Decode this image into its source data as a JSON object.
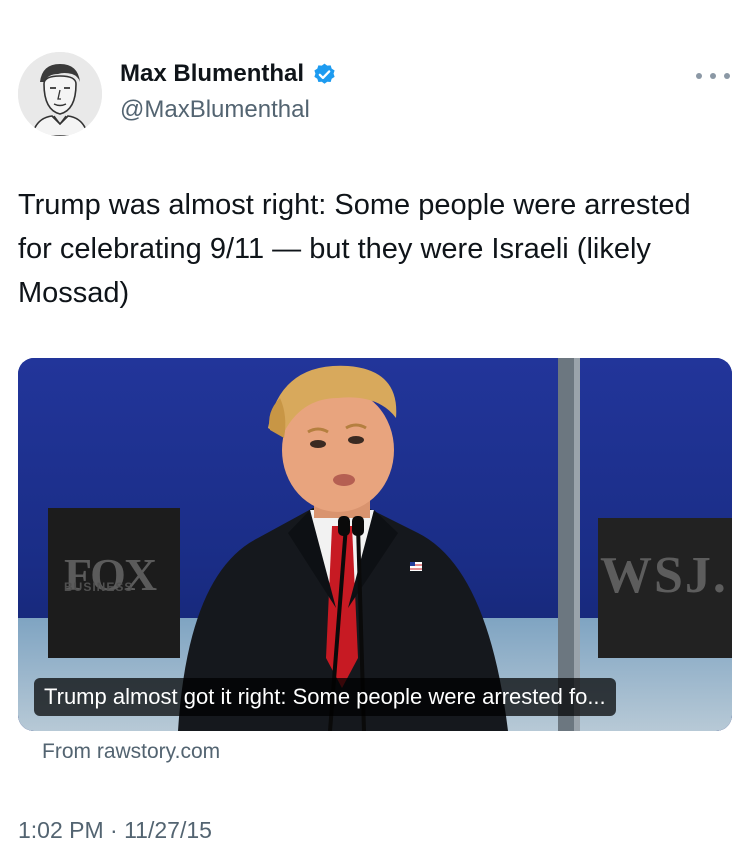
{
  "author": {
    "display_name": "Max Blumenthal",
    "handle": "@MaxBlumenthal",
    "verified": true,
    "verified_color": "#1d9bf0"
  },
  "tweet": {
    "text": "Trump was almost right: Some people were arrested for celebrating 9/11 — but they were Israeli (likely Mossad)"
  },
  "card": {
    "headline": "Trump almost got it right: Some people were arrested fo...",
    "source": "From rawstory.com",
    "photo_signs": {
      "left": "FOX",
      "left_sub": "BUSINESS",
      "right": "WSJ."
    }
  },
  "meta": {
    "timestamp": "1:02 PM · 11/27/15"
  },
  "icons": {
    "more": "more-horizontal-icon",
    "verified": "verified-badge-icon"
  },
  "colors": {
    "text_primary": "#0f1419",
    "text_secondary": "#536471",
    "card_background": "#1b2f86"
  }
}
